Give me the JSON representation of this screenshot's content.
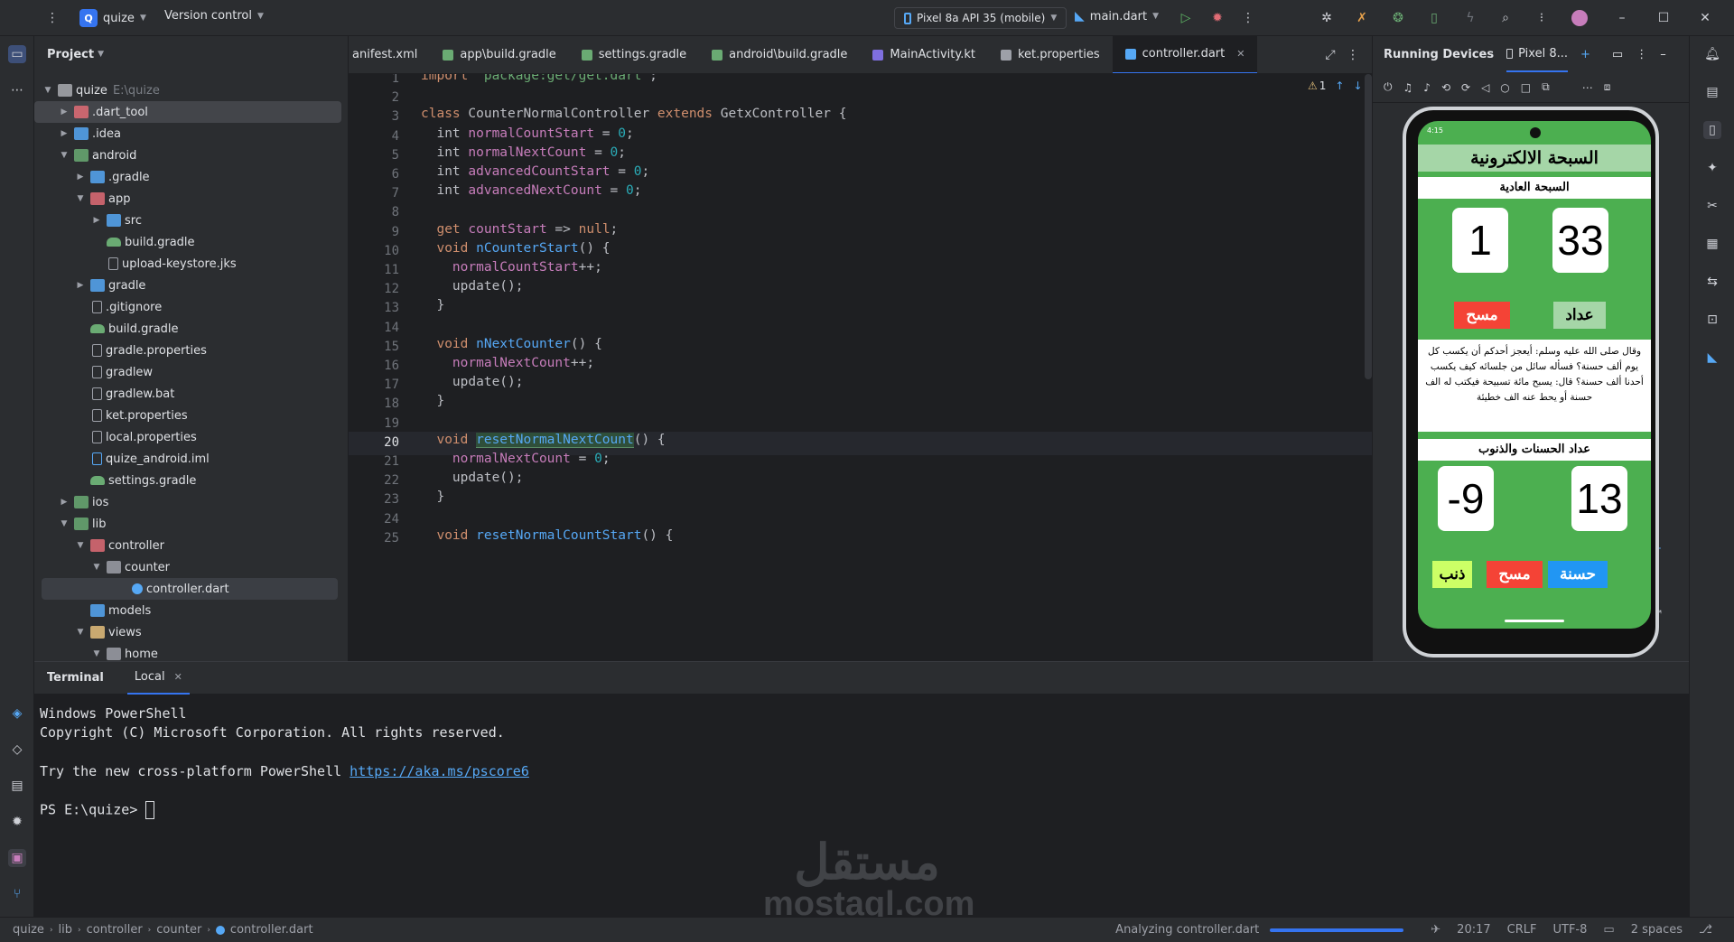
{
  "titlebar": {
    "project_badge": "Q",
    "project_name": "quize",
    "vcs": "Version control",
    "device": "Pixel 8a API 35 (mobile)",
    "run_config": "main.dart"
  },
  "project_panel": {
    "title": "Project",
    "tree": [
      {
        "label": "quize",
        "extra": "E:\\quize",
        "depth": 0,
        "arrow": "open",
        "icon": "folder",
        "color": "#a9abb0"
      },
      {
        "label": ".dart_tool",
        "depth": 1,
        "arrow": "closed",
        "icon": "folder",
        "color": "#e06c75",
        "hl": true
      },
      {
        "label": ".idea",
        "depth": 1,
        "arrow": "closed",
        "icon": "folder",
        "color": "#56a8f5"
      },
      {
        "label": "android",
        "depth": 1,
        "arrow": "open",
        "icon": "folder",
        "color": "#6aab73"
      },
      {
        "label": ".gradle",
        "depth": 2,
        "arrow": "closed",
        "icon": "folder",
        "color": "#56a8f5"
      },
      {
        "label": "app",
        "depth": 2,
        "arrow": "open",
        "icon": "folder",
        "color": "#e06c75"
      },
      {
        "label": "src",
        "depth": 3,
        "arrow": "closed",
        "icon": "folder",
        "color": "#56a8f5"
      },
      {
        "label": "build.gradle",
        "depth": 3,
        "arrow": "none",
        "icon": "gradle",
        "color": "#6aab73"
      },
      {
        "label": "upload-keystore.jks",
        "depth": 3,
        "arrow": "none",
        "icon": "file",
        "color": "#9da0a8"
      },
      {
        "label": "gradle",
        "depth": 2,
        "arrow": "closed",
        "icon": "folder",
        "color": "#56a8f5"
      },
      {
        "label": ".gitignore",
        "depth": 2,
        "arrow": "none",
        "icon": "file",
        "color": "#9da0a8"
      },
      {
        "label": "build.gradle",
        "depth": 2,
        "arrow": "none",
        "icon": "gradle",
        "color": "#6aab73"
      },
      {
        "label": "gradle.properties",
        "depth": 2,
        "arrow": "none",
        "icon": "gear",
        "color": "#9da0a8"
      },
      {
        "label": "gradlew",
        "depth": 2,
        "arrow": "none",
        "icon": "file",
        "color": "#9da0a8"
      },
      {
        "label": "gradlew.bat",
        "depth": 2,
        "arrow": "none",
        "icon": "file",
        "color": "#9da0a8"
      },
      {
        "label": "ket.properties",
        "depth": 2,
        "arrow": "none",
        "icon": "gear",
        "color": "#9da0a8"
      },
      {
        "label": "local.properties",
        "depth": 2,
        "arrow": "none",
        "icon": "gear",
        "color": "#9da0a8"
      },
      {
        "label": "quize_android.iml",
        "depth": 2,
        "arrow": "none",
        "icon": "file",
        "color": "#56a8f5"
      },
      {
        "label": "settings.gradle",
        "depth": 2,
        "arrow": "none",
        "icon": "gradle",
        "color": "#6aab73"
      },
      {
        "label": "ios",
        "depth": 1,
        "arrow": "closed",
        "icon": "folder",
        "color": "#6aab73"
      },
      {
        "label": "lib",
        "depth": 1,
        "arrow": "open",
        "icon": "folder",
        "color": "#6aab73"
      },
      {
        "label": "controller",
        "depth": 2,
        "arrow": "open",
        "icon": "folder",
        "color": "#e06c75"
      },
      {
        "label": "counter",
        "depth": 3,
        "arrow": "open",
        "icon": "folder",
        "color": "#9da0a8"
      },
      {
        "label": "controller.dart",
        "depth": 4,
        "arrow": "none",
        "icon": "dart",
        "color": "#56a8f5",
        "sel": true
      },
      {
        "label": "models",
        "depth": 2,
        "arrow": "none",
        "icon": "folder",
        "color": "#56a8f5"
      },
      {
        "label": "views",
        "depth": 2,
        "arrow": "open",
        "icon": "folder",
        "color": "#e5c07b"
      },
      {
        "label": "home",
        "depth": 3,
        "arrow": "open",
        "icon": "folder",
        "color": "#9da0a8"
      }
    ]
  },
  "tabs": [
    {
      "label": "anifest.xml",
      "color": "#e5c07b"
    },
    {
      "label": "app\\build.gradle",
      "color": "#6aab73"
    },
    {
      "label": "settings.gradle",
      "color": "#6aab73"
    },
    {
      "label": "android\\build.gradle",
      "color": "#6aab73"
    },
    {
      "label": "MainActivity.kt",
      "color": "#7f6fe0"
    },
    {
      "label": "ket.properties",
      "color": "#9da0a8"
    },
    {
      "label": "controller.dart",
      "color": "#56a8f5",
      "active": true
    }
  ],
  "editor": {
    "warnings": "1",
    "current_line": 20,
    "lines": [
      [
        [
          "kw",
          "import "
        ],
        [
          "str",
          "'package:get/get.dart'"
        ],
        [
          "typ",
          ";"
        ]
      ],
      [],
      [
        [
          "kw",
          "class "
        ],
        [
          "typ",
          "CounterNormalController "
        ],
        [
          "kw",
          "extends "
        ],
        [
          "typ",
          "GetxController {"
        ]
      ],
      [
        [
          "typ",
          "  int "
        ],
        [
          "fld",
          "normalCountStart"
        ],
        [
          "typ",
          " = "
        ],
        [
          "num",
          "0"
        ],
        [
          "typ",
          ";"
        ]
      ],
      [
        [
          "typ",
          "  int "
        ],
        [
          "fld",
          "normalNextCount"
        ],
        [
          "typ",
          " = "
        ],
        [
          "num",
          "0"
        ],
        [
          "typ",
          ";"
        ]
      ],
      [
        [
          "typ",
          "  int "
        ],
        [
          "fld",
          "advancedCountStart"
        ],
        [
          "typ",
          " = "
        ],
        [
          "num",
          "0"
        ],
        [
          "typ",
          ";"
        ]
      ],
      [
        [
          "typ",
          "  int "
        ],
        [
          "fld",
          "advancedNextCount"
        ],
        [
          "typ",
          " = "
        ],
        [
          "num",
          "0"
        ],
        [
          "typ",
          ";"
        ]
      ],
      [],
      [
        [
          "kw",
          "  get "
        ],
        [
          "fld",
          "countStart"
        ],
        [
          "typ",
          " => "
        ],
        [
          "kw",
          "null"
        ],
        [
          "typ",
          ";"
        ]
      ],
      [
        [
          "kw",
          "  void "
        ],
        [
          "fn",
          "nCounterStart"
        ],
        [
          "typ",
          "() {"
        ]
      ],
      [
        [
          "fld",
          "    normalCountStart"
        ],
        [
          "typ",
          "++;"
        ]
      ],
      [
        [
          "typ",
          "    update();"
        ]
      ],
      [
        [
          "typ",
          "  }"
        ]
      ],
      [],
      [
        [
          "kw",
          "  void "
        ],
        [
          "fn",
          "nNextCounter"
        ],
        [
          "typ",
          "() {"
        ]
      ],
      [
        [
          "fld",
          "    normalNextCount"
        ],
        [
          "typ",
          "++;"
        ]
      ],
      [
        [
          "typ",
          "    update();"
        ]
      ],
      [
        [
          "typ",
          "  }"
        ]
      ],
      [],
      [
        [
          "kw",
          "  void "
        ],
        [
          "fnhl",
          "resetNormalNextCount"
        ],
        [
          "typ",
          "() {"
        ]
      ],
      [
        [
          "fld",
          "    normalNextCount"
        ],
        [
          "typ",
          " = "
        ],
        [
          "num",
          "0"
        ],
        [
          "typ",
          ";"
        ]
      ],
      [
        [
          "typ",
          "    update();"
        ]
      ],
      [
        [
          "typ",
          "  }"
        ]
      ],
      [],
      [
        [
          "kw",
          "  void "
        ],
        [
          "fn",
          "resetNormalCountStart"
        ],
        [
          "typ",
          "() {"
        ]
      ]
    ]
  },
  "devices": {
    "title": "Running Devices",
    "tab": "Pixel 8..."
  },
  "phone": {
    "time": "4:15",
    "title": "السبحة الالكترونية",
    "section1": "السبحة العادية",
    "count_left": "1",
    "count_right": "33",
    "btn_clear": "مسح",
    "btn_count": "عداد",
    "hadith": "وقال صلى الله عليه وسلم: أيعجز أحدكم أن يكسب كل يوم ألف حسنة؟ فسأله سائل من جلسائه كيف يكسب أحدنا ألف حسنة؟ قال: يسبح مائة تسبيحة فيكتب له الف حسنة أو يحط عنه الف خطيئة",
    "section2": "عداد الحسنات والذنوب",
    "count_bad": "-9",
    "count_good": "13",
    "btn_sin": "ذنب",
    "btn_clear2": "مسح",
    "btn_good": "حسنة",
    "colors": {
      "bg": "#4caf50",
      "title_bg": "#a5d6a7",
      "red": "#f44336",
      "blue": "#2196f3",
      "lime": "#ccff66",
      "light_green": "#a5d6a7"
    }
  },
  "terminal": {
    "title": "Terminal",
    "tab": "Local",
    "lines": [
      "Windows PowerShell",
      "Copyright (C) Microsoft Corporation. All rights reserved.",
      "",
      "Try the new cross-platform PowerShell ",
      "",
      "PS E:\\quize> "
    ],
    "link": "https://aka.ms/pscore6"
  },
  "watermark": {
    "ar": "مستقل",
    "en": "mostaql.com"
  },
  "statusbar": {
    "crumbs": [
      "quize",
      "lib",
      "controller",
      "counter",
      "controller.dart"
    ],
    "analyzing": "Analyzing controller.dart",
    "position": "20:17",
    "line_sep": "CRLF",
    "encoding": "UTF-8",
    "indent": "2 spaces"
  }
}
